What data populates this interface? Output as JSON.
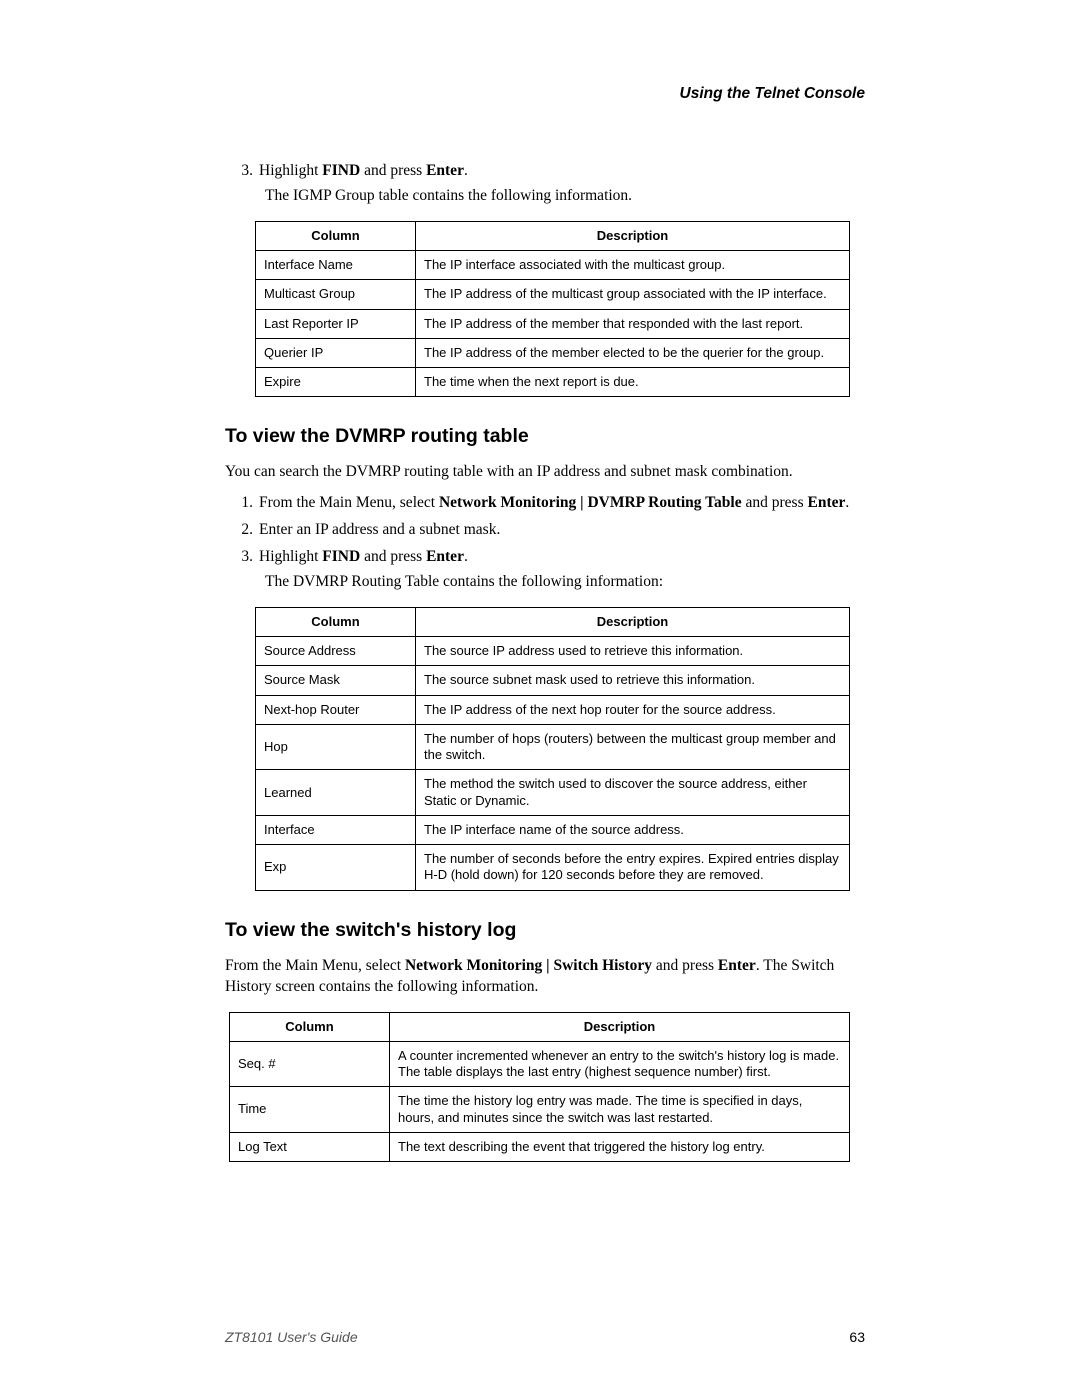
{
  "header": {
    "title": "Using the Telnet Console"
  },
  "section1": {
    "step3_num": "3.",
    "step3_prefix": "Highlight ",
    "step3_bold1": "FIND",
    "step3_mid": " and press ",
    "step3_bold2": "Enter",
    "step3_suffix": ".",
    "followup": "The IGMP Group table contains the following information.",
    "table_headers": {
      "col": "Column",
      "desc": "Description"
    },
    "rows": [
      {
        "col": "Interface Name",
        "desc": "The IP interface associated with the multicast group."
      },
      {
        "col": "Multicast Group",
        "desc": "The IP address of the multicast group associated with the IP interface."
      },
      {
        "col": "Last Reporter IP",
        "desc": "The IP address of the member that responded with the last report."
      },
      {
        "col": "Querier IP",
        "desc": "The IP address of the member elected to be the querier for the group."
      },
      {
        "col": "Expire",
        "desc": "The time when the next report is due."
      }
    ]
  },
  "section2": {
    "heading": "To view the DVMRP routing table",
    "intro": "You can search the DVMRP routing table with an IP address and subnet mask combination.",
    "step1_num": "1.",
    "step1_prefix": "From the Main Menu, select ",
    "step1_bold1": "Network Monitoring | DVMRP Routing Table",
    "step1_mid": " and press ",
    "step1_bold2": "Enter",
    "step1_suffix": ".",
    "step2_num": "2.",
    "step2_text": "Enter an IP address and a subnet mask.",
    "step3_num": "3.",
    "step3_prefix": "Highlight ",
    "step3_bold1": "FIND",
    "step3_mid": " and press ",
    "step3_bold2": "Enter",
    "step3_suffix": ".",
    "followup": "The DVMRP Routing Table contains the following information:",
    "table_headers": {
      "col": "Column",
      "desc": "Description"
    },
    "rows": [
      {
        "col": "Source Address",
        "desc": "The source IP address used to retrieve this information."
      },
      {
        "col": "Source Mask",
        "desc": "The source subnet mask used to retrieve this information."
      },
      {
        "col": "Next-hop Router",
        "desc": "The IP address of the next hop router for the source address."
      },
      {
        "col": "Hop",
        "desc": "The number of hops (routers) between the multicast group member and the switch."
      },
      {
        "col": "Learned",
        "desc": "The method the switch used to discover the source address, either Static or Dynamic."
      },
      {
        "col": "Interface",
        "desc": "The IP interface name of the source address."
      },
      {
        "col": "Exp",
        "desc": "The number of seconds before the entry expires. Expired entries display H-D (hold down) for 120 seconds before they are removed."
      }
    ]
  },
  "section3": {
    "heading": "To view the switch's history log",
    "intro_prefix": "From the Main Menu, select ",
    "intro_bold1": "Network Monitoring | Switch History",
    "intro_mid": " and press ",
    "intro_bold2": "Enter",
    "intro_suffix": ". The Switch History screen contains the following information.",
    "table_headers": {
      "col": "Column",
      "desc": "Description"
    },
    "rows": [
      {
        "col": "Seq. #",
        "desc": "A counter incremented whenever an entry to the switch's history log is made. The table displays the last entry (highest sequence number) first."
      },
      {
        "col": "Time",
        "desc": "The time the history log entry was made. The time is specified in days, hours, and minutes since the switch was last restarted."
      },
      {
        "col": "Log Text",
        "desc": "The text describing the event that triggered the history log entry."
      }
    ]
  },
  "footer": {
    "left": "ZT8101 User's Guide",
    "right": "63"
  }
}
